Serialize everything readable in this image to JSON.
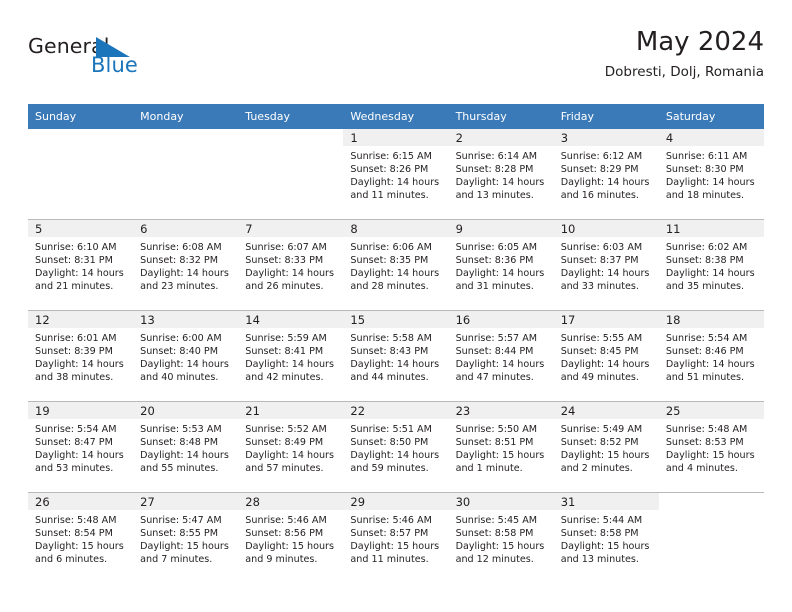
{
  "brand": {
    "name_part1": "General",
    "name_part2": "Blue",
    "flag_icon": "flag-triangle-icon",
    "blue_hex": "#1b75bb",
    "dark_hex": "#231f20"
  },
  "header": {
    "title": "May 2024",
    "subtitle": "Dobresti, Dolj, Romania"
  },
  "calendar": {
    "header_bg": "#3b7ab8",
    "daynum_band_bg": "#f0f0f0",
    "grid_line": "#b9b9b9",
    "weekday_headers": [
      "Sunday",
      "Monday",
      "Tuesday",
      "Wednesday",
      "Thursday",
      "Friday",
      "Saturday"
    ],
    "weeks": [
      [
        {
          "day": "",
          "lines": []
        },
        {
          "day": "",
          "lines": []
        },
        {
          "day": "",
          "lines": []
        },
        {
          "day": "1",
          "lines": [
            "Sunrise: 6:15 AM",
            "Sunset: 8:26 PM",
            "Daylight: 14 hours",
            "and 11 minutes."
          ]
        },
        {
          "day": "2",
          "lines": [
            "Sunrise: 6:14 AM",
            "Sunset: 8:28 PM",
            "Daylight: 14 hours",
            "and 13 minutes."
          ]
        },
        {
          "day": "3",
          "lines": [
            "Sunrise: 6:12 AM",
            "Sunset: 8:29 PM",
            "Daylight: 14 hours",
            "and 16 minutes."
          ]
        },
        {
          "day": "4",
          "lines": [
            "Sunrise: 6:11 AM",
            "Sunset: 8:30 PM",
            "Daylight: 14 hours",
            "and 18 minutes."
          ]
        }
      ],
      [
        {
          "day": "5",
          "lines": [
            "Sunrise: 6:10 AM",
            "Sunset: 8:31 PM",
            "Daylight: 14 hours",
            "and 21 minutes."
          ]
        },
        {
          "day": "6",
          "lines": [
            "Sunrise: 6:08 AM",
            "Sunset: 8:32 PM",
            "Daylight: 14 hours",
            "and 23 minutes."
          ]
        },
        {
          "day": "7",
          "lines": [
            "Sunrise: 6:07 AM",
            "Sunset: 8:33 PM",
            "Daylight: 14 hours",
            "and 26 minutes."
          ]
        },
        {
          "day": "8",
          "lines": [
            "Sunrise: 6:06 AM",
            "Sunset: 8:35 PM",
            "Daylight: 14 hours",
            "and 28 minutes."
          ]
        },
        {
          "day": "9",
          "lines": [
            "Sunrise: 6:05 AM",
            "Sunset: 8:36 PM",
            "Daylight: 14 hours",
            "and 31 minutes."
          ]
        },
        {
          "day": "10",
          "lines": [
            "Sunrise: 6:03 AM",
            "Sunset: 8:37 PM",
            "Daylight: 14 hours",
            "and 33 minutes."
          ]
        },
        {
          "day": "11",
          "lines": [
            "Sunrise: 6:02 AM",
            "Sunset: 8:38 PM",
            "Daylight: 14 hours",
            "and 35 minutes."
          ]
        }
      ],
      [
        {
          "day": "12",
          "lines": [
            "Sunrise: 6:01 AM",
            "Sunset: 8:39 PM",
            "Daylight: 14 hours",
            "and 38 minutes."
          ]
        },
        {
          "day": "13",
          "lines": [
            "Sunrise: 6:00 AM",
            "Sunset: 8:40 PM",
            "Daylight: 14 hours",
            "and 40 minutes."
          ]
        },
        {
          "day": "14",
          "lines": [
            "Sunrise: 5:59 AM",
            "Sunset: 8:41 PM",
            "Daylight: 14 hours",
            "and 42 minutes."
          ]
        },
        {
          "day": "15",
          "lines": [
            "Sunrise: 5:58 AM",
            "Sunset: 8:43 PM",
            "Daylight: 14 hours",
            "and 44 minutes."
          ]
        },
        {
          "day": "16",
          "lines": [
            "Sunrise: 5:57 AM",
            "Sunset: 8:44 PM",
            "Daylight: 14 hours",
            "and 47 minutes."
          ]
        },
        {
          "day": "17",
          "lines": [
            "Sunrise: 5:55 AM",
            "Sunset: 8:45 PM",
            "Daylight: 14 hours",
            "and 49 minutes."
          ]
        },
        {
          "day": "18",
          "lines": [
            "Sunrise: 5:54 AM",
            "Sunset: 8:46 PM",
            "Daylight: 14 hours",
            "and 51 minutes."
          ]
        }
      ],
      [
        {
          "day": "19",
          "lines": [
            "Sunrise: 5:54 AM",
            "Sunset: 8:47 PM",
            "Daylight: 14 hours",
            "and 53 minutes."
          ]
        },
        {
          "day": "20",
          "lines": [
            "Sunrise: 5:53 AM",
            "Sunset: 8:48 PM",
            "Daylight: 14 hours",
            "and 55 minutes."
          ]
        },
        {
          "day": "21",
          "lines": [
            "Sunrise: 5:52 AM",
            "Sunset: 8:49 PM",
            "Daylight: 14 hours",
            "and 57 minutes."
          ]
        },
        {
          "day": "22",
          "lines": [
            "Sunrise: 5:51 AM",
            "Sunset: 8:50 PM",
            "Daylight: 14 hours",
            "and 59 minutes."
          ]
        },
        {
          "day": "23",
          "lines": [
            "Sunrise: 5:50 AM",
            "Sunset: 8:51 PM",
            "Daylight: 15 hours",
            "and 1 minute."
          ]
        },
        {
          "day": "24",
          "lines": [
            "Sunrise: 5:49 AM",
            "Sunset: 8:52 PM",
            "Daylight: 15 hours",
            "and 2 minutes."
          ]
        },
        {
          "day": "25",
          "lines": [
            "Sunrise: 5:48 AM",
            "Sunset: 8:53 PM",
            "Daylight: 15 hours",
            "and 4 minutes."
          ]
        }
      ],
      [
        {
          "day": "26",
          "lines": [
            "Sunrise: 5:48 AM",
            "Sunset: 8:54 PM",
            "Daylight: 15 hours",
            "and 6 minutes."
          ]
        },
        {
          "day": "27",
          "lines": [
            "Sunrise: 5:47 AM",
            "Sunset: 8:55 PM",
            "Daylight: 15 hours",
            "and 7 minutes."
          ]
        },
        {
          "day": "28",
          "lines": [
            "Sunrise: 5:46 AM",
            "Sunset: 8:56 PM",
            "Daylight: 15 hours",
            "and 9 minutes."
          ]
        },
        {
          "day": "29",
          "lines": [
            "Sunrise: 5:46 AM",
            "Sunset: 8:57 PM",
            "Daylight: 15 hours",
            "and 11 minutes."
          ]
        },
        {
          "day": "30",
          "lines": [
            "Sunrise: 5:45 AM",
            "Sunset: 8:58 PM",
            "Daylight: 15 hours",
            "and 12 minutes."
          ]
        },
        {
          "day": "31",
          "lines": [
            "Sunrise: 5:44 AM",
            "Sunset: 8:58 PM",
            "Daylight: 15 hours",
            "and 13 minutes."
          ]
        },
        {
          "day": "",
          "lines": []
        }
      ]
    ]
  }
}
